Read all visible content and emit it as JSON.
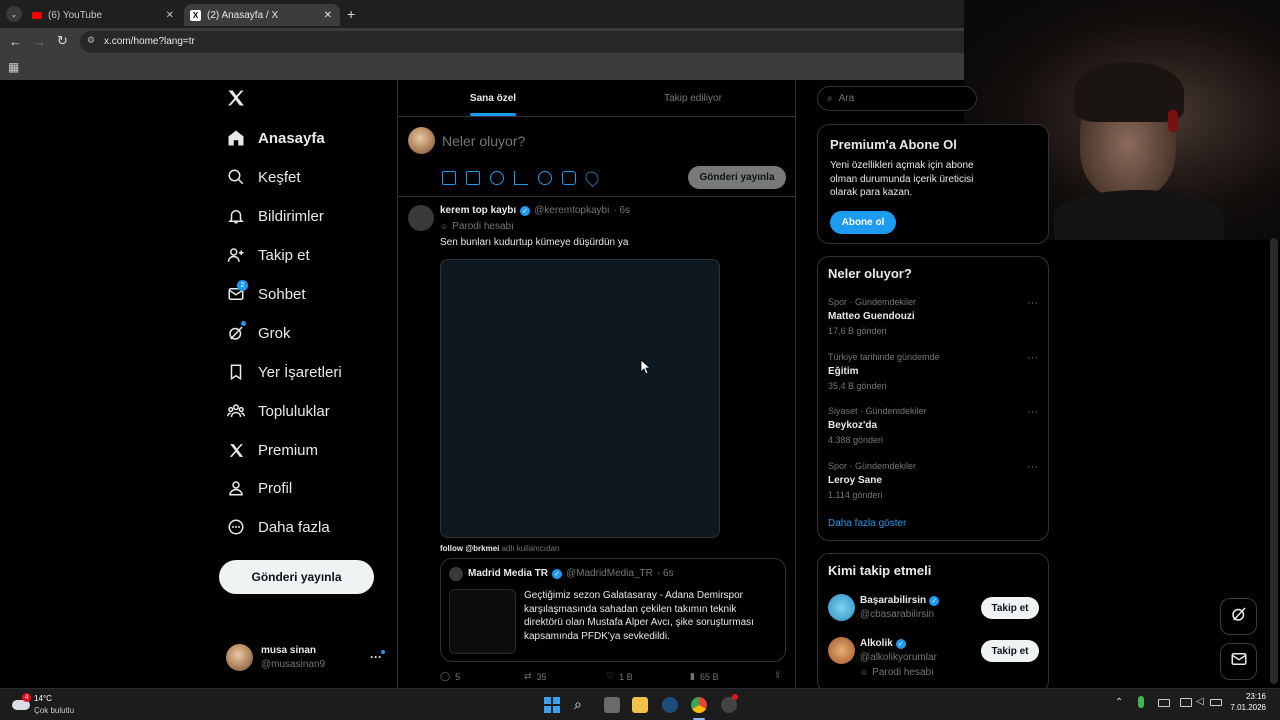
{
  "browser": {
    "tabs": [
      {
        "title": "(6) YouTube",
        "active": false
      },
      {
        "title": "(2) Anasayfa / X",
        "active": true
      }
    ],
    "url": "x.com/home?lang=tr",
    "new_tab": "+"
  },
  "sidebar": {
    "logo": "X",
    "items": [
      {
        "label": "Anasayfa",
        "icon": "home-icon"
      },
      {
        "label": "Keşfet",
        "icon": "search-icon"
      },
      {
        "label": "Bildirimler",
        "icon": "bell-icon"
      },
      {
        "label": "Takip et",
        "icon": "person-add-icon"
      },
      {
        "label": "Sohbet",
        "icon": "mail-icon",
        "badge": "2"
      },
      {
        "label": "Grok",
        "icon": "grok-icon"
      },
      {
        "label": "Yer İşaretleri",
        "icon": "bookmark-icon"
      },
      {
        "label": "Topluluklar",
        "icon": "communities-icon"
      },
      {
        "label": "Premium",
        "icon": "x-logo-icon"
      },
      {
        "label": "Profil",
        "icon": "person-icon"
      },
      {
        "label": "Daha fazla",
        "icon": "more-circle-icon"
      }
    ],
    "post_button": "Gönderi yayınla",
    "account": {
      "name": "musa sinan",
      "handle": "@musasinan9",
      "more": "···"
    }
  },
  "feed": {
    "tabs": [
      {
        "label": "Sana özel",
        "active": true
      },
      {
        "label": "Takip ediliyor",
        "active": false
      }
    ],
    "composer": {
      "placeholder": "Neler oluyor?",
      "post_button": "Gönderi yayınla"
    },
    "tweet": {
      "author": "kerem top kaybı",
      "handle": "@keremtopkaybi",
      "time": "· 6s",
      "label": "Parodi hesabı",
      "text": "Sen bunları kudurtup kümeye düşürdün ya",
      "caption_user": "follow @brkmei",
      "caption_rest": "adlı kullanıcıdan",
      "quoted": {
        "author": "Madrid Media TR",
        "handle": "@MadridMedia_TR",
        "time": "· 6s",
        "text": "Geçtiğimiz sezon Galatasaray - Adana Demirspor karşılaşmasında sahadan çekilen takımın teknik direktörü olan Mustafa Alper Avcı, şike soruşturması kapsamında PFDK'ya sevkedildi."
      },
      "actions": {
        "replies": "5",
        "reposts": "35",
        "likes": "1 B",
        "views": "65 B"
      }
    }
  },
  "right": {
    "search_placeholder": "Ara",
    "premium": {
      "title": "Premium'a Abone Ol",
      "text": "Yeni özellikleri açmak için abone olman durumunda içerik üreticisi olarak para kazan.",
      "button": "Abone ol"
    },
    "trends": {
      "title": "Neler oluyor?",
      "items": [
        {
          "category": "Spor · Gündemdekiler",
          "name": "Matteo Guendouzi",
          "count": "17,6 B gönderi"
        },
        {
          "category": "Türkiye tarihinde gündemde",
          "name": "Eğitim",
          "count": "35,4 B gönderi"
        },
        {
          "category": "Siyaset · Gündemdekiler",
          "name": "Beykoz'da",
          "count": "4.388 gönderi"
        },
        {
          "category": "Spor · Gündemdekiler",
          "name": "Leroy Sane",
          "count": "1.114 gönderi"
        }
      ],
      "show_more": "Daha fazla göster"
    },
    "who_to_follow": {
      "title": "Kimi takip etmeli",
      "items": [
        {
          "name": "Başarabilirsin",
          "handle": "@cbasarabilirsin",
          "button": "Takip et"
        },
        {
          "name": "Alkolik",
          "handle": "@alkolikyorumlar",
          "label": "Parodi hesabı",
          "button": "Takip et"
        }
      ]
    }
  },
  "taskbar": {
    "weather_temp": "14°C",
    "weather_desc": "Çok bulutlu",
    "weather_badge": "4",
    "time": "23:16",
    "date": "7.01.2026"
  }
}
